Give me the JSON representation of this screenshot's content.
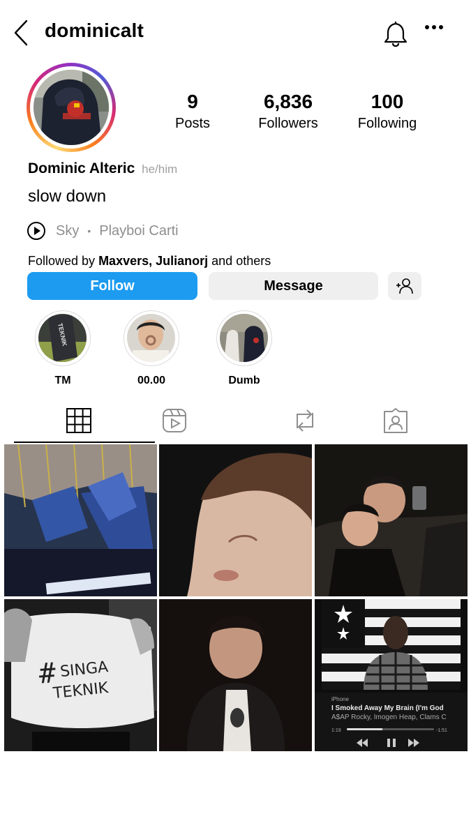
{
  "header": {
    "username": "dominicalt",
    "icons": [
      "chevron-left-icon",
      "bell-icon",
      "more-icon"
    ]
  },
  "profile": {
    "stats": {
      "posts_value": "9",
      "posts_label": "Posts",
      "followers_value": "6,836",
      "followers_label": "Followers",
      "following_value": "100",
      "following_label": "Following"
    },
    "display_name": "Dominic Alteric",
    "pronouns": "he/him",
    "bio": "slow down",
    "music": {
      "song": "Sky",
      "artist": "Playboi Carti"
    },
    "followed_by": {
      "prefix": "Followed by",
      "names": "Maxvers, Julianorj",
      "suffix": "and others"
    }
  },
  "actions": {
    "follow_label": "Follow",
    "message_label": "Message"
  },
  "highlights": [
    {
      "label": "TM"
    },
    {
      "label": "00.00"
    },
    {
      "label": "Dumb"
    }
  ],
  "tabs": [
    "grid-icon",
    "reels-icon",
    "reposts-icon",
    "tagged-icon"
  ],
  "posts": [
    {
      "id": "post-1"
    },
    {
      "id": "post-2"
    },
    {
      "id": "post-3"
    },
    {
      "id": "post-4",
      "caption": "#SINGA TEKNIK"
    },
    {
      "id": "post-5"
    },
    {
      "id": "post-6",
      "source": "iPhone",
      "title": "I Smoked Away My Brain (I'm God",
      "artists": "A$AP Rocky, Imogen Heap, Clams C",
      "elapsed": "1:19",
      "remaining": "-1:51",
      "progress": 0.41
    }
  ],
  "colors": {
    "follow_button": "#1c9bf0",
    "secondary_button": "#efefef",
    "muted_text": "#8e8e8e"
  }
}
